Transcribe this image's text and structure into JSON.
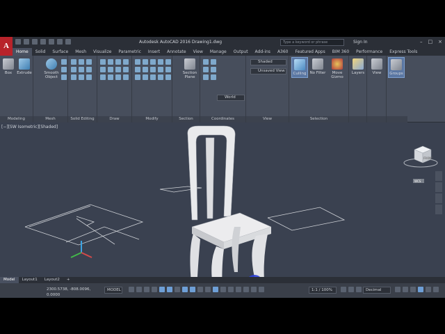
{
  "app": {
    "title": "Autodesk AutoCAD 2016   Drawing1.dwg",
    "logo_letter": "A",
    "search_placeholder": "Type a keyword or phrase",
    "signin": "Sign In"
  },
  "tabs": [
    "Home",
    "Solid",
    "Surface",
    "Mesh",
    "Visualize",
    "Parametric",
    "Insert",
    "Annotate",
    "View",
    "Manage",
    "Output",
    "Add-ins",
    "A360",
    "Featured Apps",
    "BIM 360",
    "Performance",
    "Express Tools"
  ],
  "active_tab": "Home",
  "ribbon": {
    "panels": {
      "modeling": "Modeling",
      "mesh": "Mesh",
      "solid_editing": "Solid Editing",
      "draw": "Draw",
      "modify": "Modify",
      "section": "Section",
      "coordinates": "Coordinates",
      "view": "View",
      "selection": "Selection"
    },
    "buttons": {
      "box": "Box",
      "extrude": "Extrude",
      "smooth_object": "Smooth Object",
      "section_plane": "Section Plane",
      "culling": "Culling",
      "no_filter": "No Filter",
      "move_gizmo": "Move Gizmo",
      "layers": "Layers",
      "view": "View",
      "groups": "Groups"
    },
    "combos": {
      "visual_style": "Shaded",
      "named_view": "Unsaved View",
      "ucs": "World"
    }
  },
  "viewport": {
    "label": "[−][SW Isometric][Shaded]",
    "viewcube_face": "FRONT",
    "wcs_label": "WCS"
  },
  "model_tabs": [
    "Model",
    "Layout1",
    "Layout2",
    "+"
  ],
  "active_model_tab": "Model",
  "status": {
    "coordinates": "2300.5738, -808.0096, 0.0000",
    "space": "MODEL",
    "scale": "1:1 / 100%",
    "units": "Decimal"
  },
  "colors": {
    "viewport_bg": "#3a4150",
    "ribbon_bg": "#474e5c",
    "accent": "#b8232a"
  }
}
